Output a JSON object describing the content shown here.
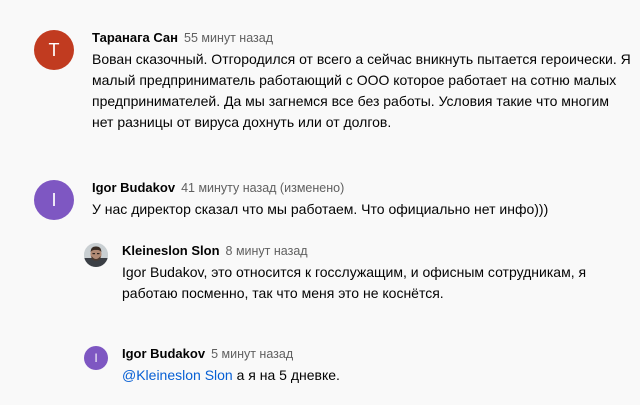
{
  "comments": [
    {
      "author": "Таранага Сан",
      "time": "55 минут назад",
      "avatar_letter": "Т",
      "avatar_color": "#c13b20",
      "text": "Вован сказочный. Отгородился от всего а сейчас вникнуть пытается героически. Я малый предприниматель работающий с ООО которое работает на сотню малых предпринимателей. Да мы загнемся все без работы. Условия такие что многим нет разницы от вируса дохнуть или от долгов."
    },
    {
      "author": "Igor Budakov",
      "time": "41 минуту назад (изменено)",
      "avatar_letter": "I",
      "avatar_color": "#7e57c2",
      "text": "У нас директор сказал что мы работаем. Что официально нет инфо)))"
    },
    {
      "author": "Kleineslon Slon",
      "time": "8 минут назад",
      "avatar_icon": "user-photo-icon",
      "text": "Igor Budakov, это относится к госслужащим, и офисным сотрудникам, я работаю посменно, так что меня это не коснётся."
    },
    {
      "author": "Igor Budakov",
      "time": "5 минут назад",
      "avatar_letter": "I",
      "avatar_color": "#7e57c2",
      "mention": "@Kleineslon Slon",
      "text": " а я на 5 дневке."
    }
  ]
}
